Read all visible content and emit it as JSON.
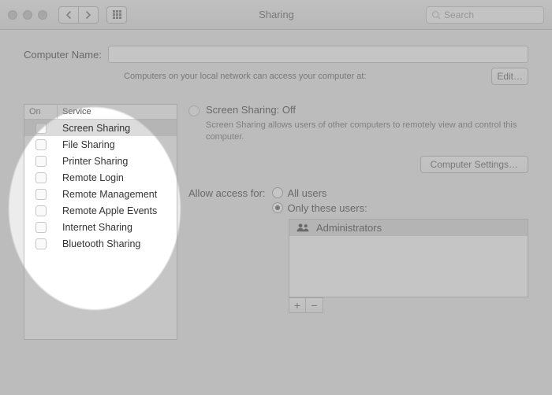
{
  "toolbar": {
    "title": "Sharing",
    "search_placeholder": "Search"
  },
  "computer_name": {
    "label": "Computer Name:",
    "value": "",
    "hint": "Computers on your local network can access your computer at:",
    "edit_label": "Edit…"
  },
  "services": {
    "header_on": "On",
    "header_service": "Service",
    "items": [
      {
        "label": "Screen Sharing",
        "on": false,
        "selected": true
      },
      {
        "label": "File Sharing",
        "on": false
      },
      {
        "label": "Printer Sharing",
        "on": false
      },
      {
        "label": "Remote Login",
        "on": false
      },
      {
        "label": "Remote Management",
        "on": false
      },
      {
        "label": "Remote Apple Events",
        "on": false
      },
      {
        "label": "Internet Sharing",
        "on": false
      },
      {
        "label": "Bluetooth Sharing",
        "on": false
      }
    ]
  },
  "detail": {
    "title": "Screen Sharing: Off",
    "description": "Screen Sharing allows users of other computers to remotely view and control this computer.",
    "computer_settings_label": "Computer Settings…",
    "allow_label": "Allow access for:",
    "opt_all": "All users",
    "opt_only": "Only these users:",
    "selected_option": "only",
    "users": [
      "Administrators"
    ]
  }
}
